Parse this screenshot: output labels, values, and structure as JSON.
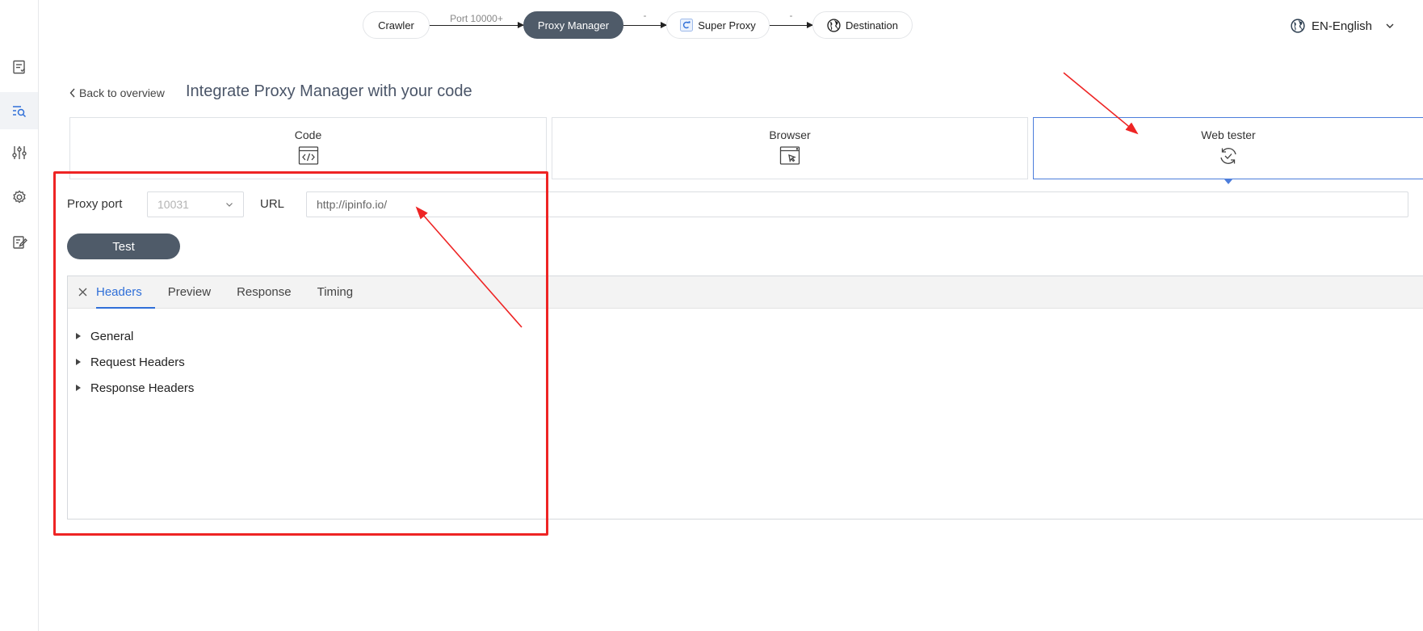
{
  "flow": {
    "nodes": [
      {
        "label": "Crawler",
        "icon": ""
      },
      {
        "label": "Proxy Manager",
        "icon": ""
      },
      {
        "label": "Super Proxy",
        "icon": "super-proxy-icon"
      },
      {
        "label": "Destination",
        "icon": "globe-icon"
      }
    ],
    "links": [
      "Port 10000+",
      "-",
      "-"
    ]
  },
  "language": {
    "label": "EN-English",
    "icon": "globe-icon"
  },
  "sidebar": {
    "items": [
      {
        "icon": "document-list-icon",
        "active": false
      },
      {
        "icon": "search-list-icon",
        "active": true
      },
      {
        "icon": "sliders-icon",
        "active": false
      },
      {
        "icon": "gear-icon",
        "active": false
      },
      {
        "icon": "edit-document-icon",
        "active": false
      }
    ]
  },
  "header": {
    "back_label": "Back to overview",
    "title": "Integrate Proxy Manager with your code"
  },
  "cards": [
    {
      "label": "Code",
      "icon": "code-window-icon",
      "active": false
    },
    {
      "label": "Browser",
      "icon": "browser-cursor-icon",
      "active": false
    },
    {
      "label": "Web tester",
      "icon": "refresh-check-icon",
      "active": true
    }
  ],
  "form": {
    "port_label": "Proxy port",
    "port_value": "10031",
    "url_label": "URL",
    "url_value": "http://ipinfo.io/",
    "test_label": "Test"
  },
  "panel": {
    "tabs": [
      {
        "label": "Headers",
        "active": true
      },
      {
        "label": "Preview",
        "active": false
      },
      {
        "label": "Response",
        "active": false
      },
      {
        "label": "Timing",
        "active": false
      }
    ],
    "sections": [
      "General",
      "Request Headers",
      "Response Headers"
    ]
  },
  "colors": {
    "accent": "#2f6fd8",
    "dark_button": "#4f5b69",
    "annotation_red": "#ee2424"
  }
}
